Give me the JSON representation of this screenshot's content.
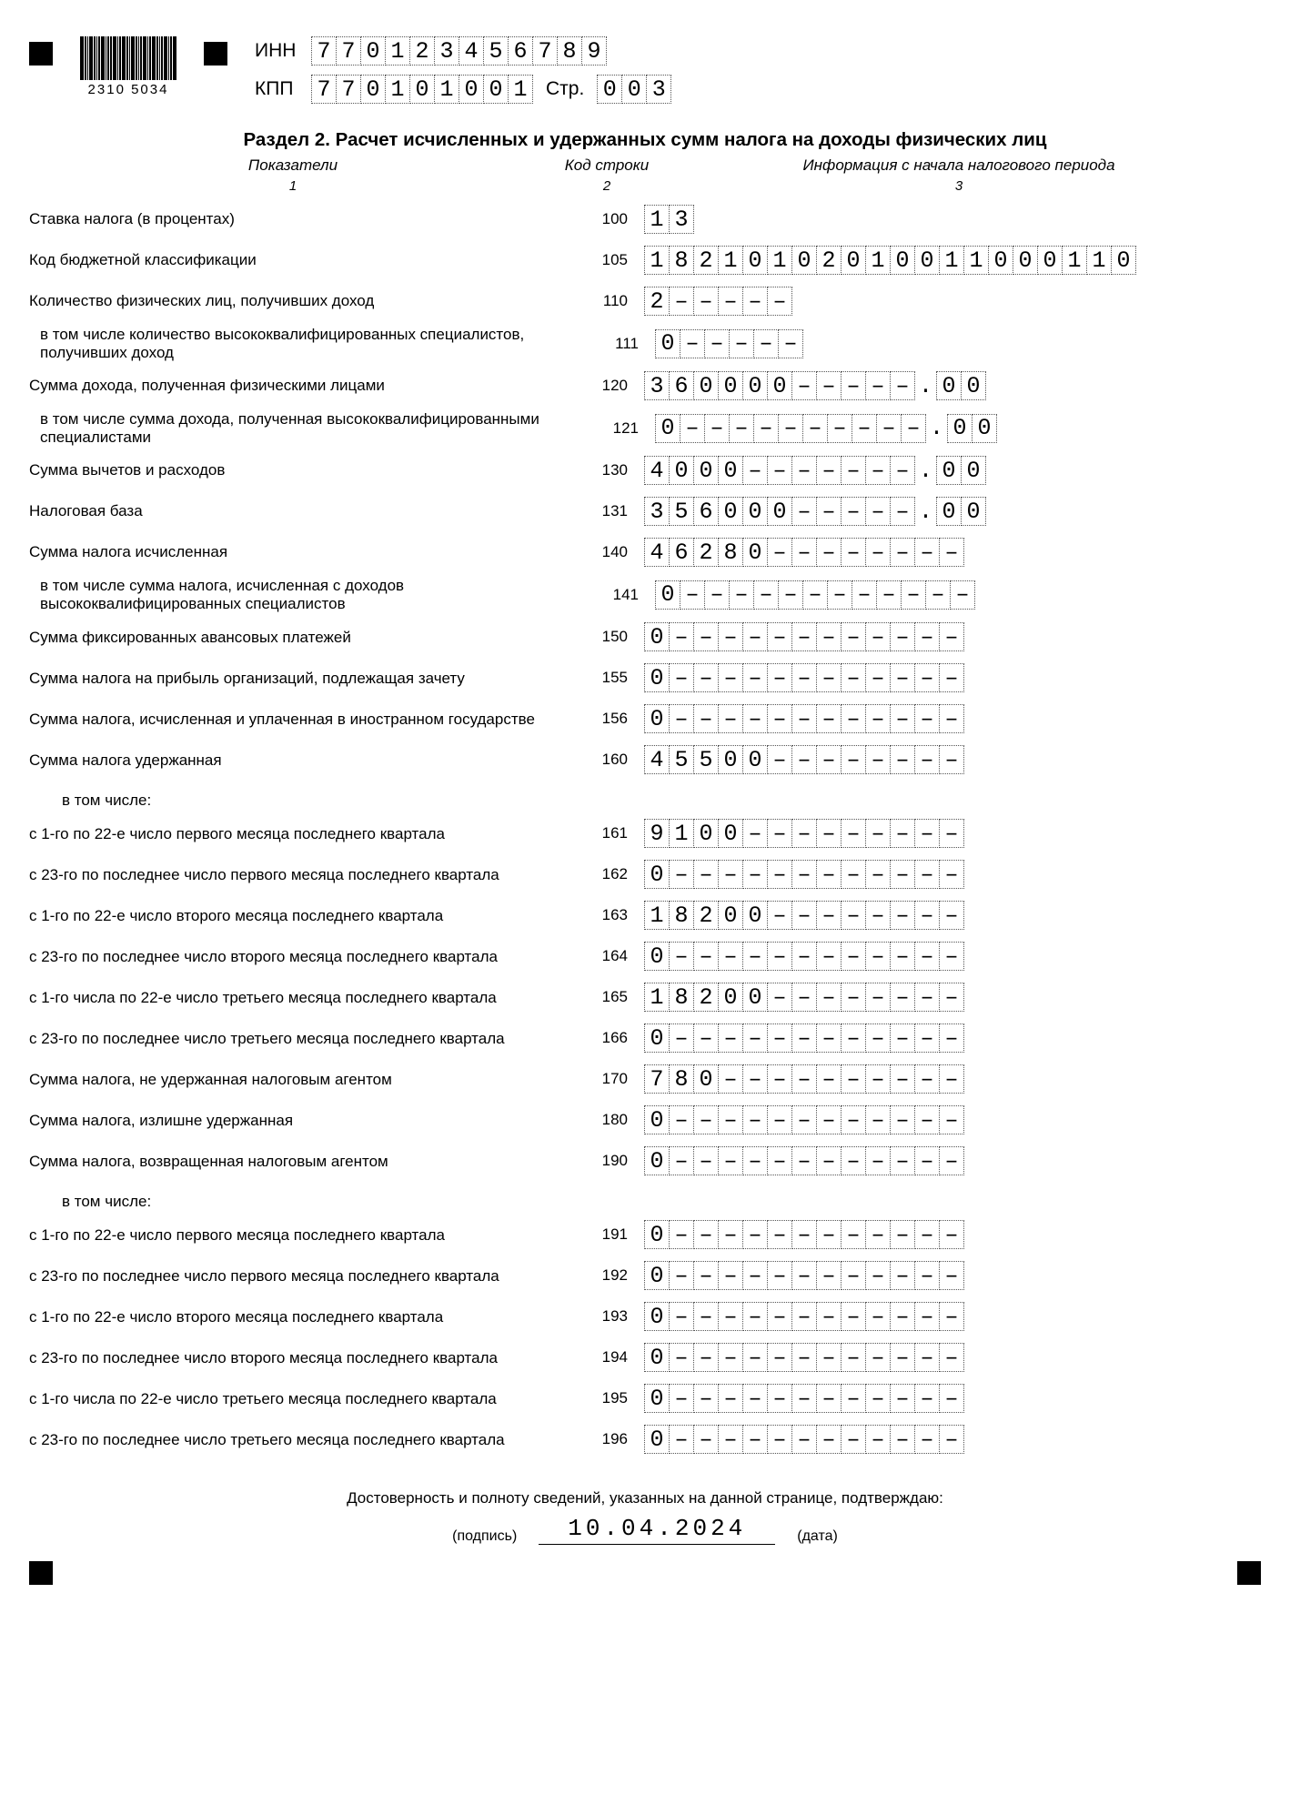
{
  "barcode_num": "2310  5034",
  "inn_label": "ИНН",
  "kpp_label": "КПП",
  "page_label": "Стр.",
  "inn": "770123456789",
  "kpp": "770101001",
  "page": "003",
  "title": "Раздел 2. Расчет исчисленных и удержанных сумм налога на доходы физических лиц",
  "colhdr": {
    "c1": "Показатели",
    "c2": "Код строки",
    "c3": "Информация с начала налогового периода",
    "s1": "1",
    "s2": "2",
    "s3": "3"
  },
  "note_incl": "в том числе:",
  "rows": [
    {
      "label": "Ставка налога (в процентах)",
      "code": "100",
      "v": "13",
      "len": 2
    },
    {
      "label": "Код бюджетной классификации",
      "code": "105",
      "v": "18210102010011000110",
      "len": 20
    },
    {
      "label": "Количество физических лиц, получивших доход",
      "code": "110",
      "v": "2",
      "len": 6
    },
    {
      "label": "в том числе количество высококвалифицированных специалистов, получивших доход",
      "code": "111",
      "v": "0",
      "len": 6,
      "indent": true
    },
    {
      "label": "Сумма дохода, полученная физическими лицами",
      "code": "120",
      "v": "360000",
      "len": 11,
      "dec": "00"
    },
    {
      "label": "в том числе сумма дохода, полученная высококвалифицированными специалистами",
      "code": "121",
      "v": "0",
      "len": 11,
      "dec": "00",
      "indent": true
    },
    {
      "label": "Сумма вычетов и расходов",
      "code": "130",
      "v": "4000",
      "len": 11,
      "dec": "00"
    },
    {
      "label": "Налоговая база",
      "code": "131",
      "v": "356000",
      "len": 11,
      "dec": "00"
    },
    {
      "label": "Сумма налога исчисленная",
      "code": "140",
      "v": "46280",
      "len": 13
    },
    {
      "label": "в том числе сумма налога, исчисленная с доходов высококвалифицированных специалистов",
      "code": "141",
      "v": "0",
      "len": 13,
      "indent": true
    },
    {
      "label": "Сумма фиксированных авансовых платежей",
      "code": "150",
      "v": "0",
      "len": 13
    },
    {
      "label": "Сумма налога на прибыль организаций, подлежащая зачету",
      "code": "155",
      "v": "0",
      "len": 13
    },
    {
      "label": "Сумма налога, исчисленная и уплаченная в иностранном государстве",
      "code": "156",
      "v": "0",
      "len": 13
    },
    {
      "label": "Сумма налога удержанная",
      "code": "160",
      "v": "45500",
      "len": 13,
      "note_after": true
    },
    {
      "label": "с 1-го по 22-е число первого месяца последнего квартала",
      "code": "161",
      "v": "9100",
      "len": 13
    },
    {
      "label": "с 23-го по последнее число первого месяца последнего квартала",
      "code": "162",
      "v": "0",
      "len": 13
    },
    {
      "label": "с 1-го по 22-е число второго месяца последнего квартала",
      "code": "163",
      "v": "18200",
      "len": 13
    },
    {
      "label": "с 23-го по последнее число второго месяца последнего квартала",
      "code": "164",
      "v": "0",
      "len": 13
    },
    {
      "label": "с 1-го числа по 22-е число третьего месяца последнего квартала",
      "code": "165",
      "v": "18200",
      "len": 13
    },
    {
      "label": "с 23-го по последнее число третьего месяца последнего квартала",
      "code": "166",
      "v": "0",
      "len": 13
    },
    {
      "label": "Сумма налога, не удержанная налоговым агентом",
      "code": "170",
      "v": "780",
      "len": 13
    },
    {
      "label": "Сумма налога, излишне удержанная",
      "code": "180",
      "v": "0",
      "len": 13
    },
    {
      "label": "Сумма налога, возвращенная налоговым агентом",
      "code": "190",
      "v": "0",
      "len": 13,
      "note_after": true
    },
    {
      "label": "с 1-го по 22-е число первого месяца последнего квартала",
      "code": "191",
      "v": "0",
      "len": 13
    },
    {
      "label": "с 23-го по последнее число первого месяца последнего квартала",
      "code": "192",
      "v": "0",
      "len": 13
    },
    {
      "label": "с 1-го по 22-е число второго месяца последнего квартала",
      "code": "193",
      "v": "0",
      "len": 13
    },
    {
      "label": "с 23-го по последнее число второго месяца последнего квартала",
      "code": "194",
      "v": "0",
      "len": 13
    },
    {
      "label": "с 1-го числа по 22-е число третьего месяца последнего квартала",
      "code": "195",
      "v": "0",
      "len": 13
    },
    {
      "label": "с 23-го по последнее число третьего месяца последнего квартала",
      "code": "196",
      "v": "0",
      "len": 13
    }
  ],
  "footer": {
    "text": "Достоверность и полноту сведений, указанных на данной странице, подтверждаю:",
    "sig": "(подпись)",
    "date": "10.04.2024",
    "date_lab": "(дата)"
  }
}
